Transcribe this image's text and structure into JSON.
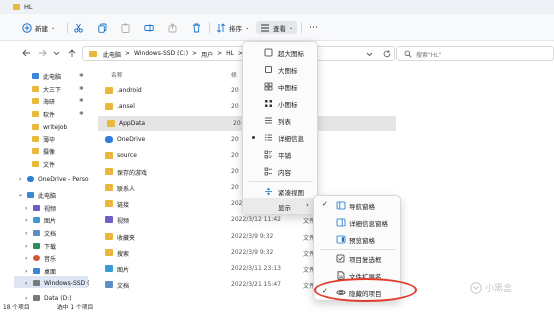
{
  "window": {
    "title": "HL"
  },
  "toolbar": {
    "new_label": "新建",
    "sort_label": "排序",
    "view_label": "查看",
    "more_label": "⋯"
  },
  "address": {
    "crumbs": [
      "此电脑",
      ">",
      "Windows-SSD (C:)",
      ">",
      "用户",
      ">",
      "HL",
      ">"
    ],
    "search_placeholder": "搜索\"HL\""
  },
  "sidebar": {
    "items": [
      {
        "label": "此电脑",
        "color": "#3a86d6"
      },
      {
        "label": "大三下",
        "color": "#e8b93c"
      },
      {
        "label": "海研",
        "color": "#e8b93c"
      },
      {
        "label": "软件",
        "color": "#e8b93c"
      },
      {
        "label": "writeJob",
        "color": "#e8b93c"
      },
      {
        "label": "薄毕",
        "color": "#e8b93c"
      },
      {
        "label": "摄像",
        "color": "#e8b93c"
      },
      {
        "label": "文件",
        "color": "#e8b93c"
      },
      {
        "label": "OneDrive - Perso",
        "color": "#2f7ed8"
      },
      {
        "label": "此电脑",
        "color": "#3a86d6"
      },
      {
        "label": "视频",
        "color": "#6c5fc7"
      },
      {
        "label": "图片",
        "color": "#3a9bd6"
      },
      {
        "label": "文档",
        "color": "#5d8ec7"
      },
      {
        "label": "下载",
        "color": "#2c8c5a"
      },
      {
        "label": "音乐",
        "color": "#d6553a"
      },
      {
        "label": "桌面",
        "color": "#3a86d6"
      },
      {
        "label": "Windows-SSD (",
        "color": "#7a7a7a"
      },
      {
        "label": "Data (D:)",
        "color": "#7a7a7a"
      }
    ],
    "pin_symbol": "✱"
  },
  "files": {
    "headers": {
      "name": "名称",
      "date": "修",
      "type": "类"
    },
    "rows": [
      {
        "name": ".android",
        "date": "20",
        "type": "",
        "color": "#e8b93c"
      },
      {
        "name": ".ansel",
        "date": "20",
        "type": "",
        "color": "#e8b93c"
      },
      {
        "name": "AppData",
        "date": "20",
        "type": "",
        "color": "#e8b93c"
      },
      {
        "name": "OneDrive",
        "date": "20",
        "type": "",
        "color": "#2f7ed8"
      },
      {
        "name": "source",
        "date": "20",
        "type": "",
        "color": "#e8b93c"
      },
      {
        "name": "保存的游戏",
        "date": "20",
        "type": "",
        "color": "#e8b93c"
      },
      {
        "name": "联系人",
        "date": "20",
        "type": "",
        "color": "#e8b93c"
      },
      {
        "name": "链接",
        "date": "2022/3/12 11:40",
        "type": "文件",
        "color": "#e8b93c"
      },
      {
        "name": "视频",
        "date": "2022/3/12 11:42",
        "type": "文件",
        "color": "#6c5fc7"
      },
      {
        "name": "收藏夹",
        "date": "2022/3/9 9:32",
        "type": "文件",
        "color": "#e8b93c"
      },
      {
        "name": "搜索",
        "date": "2022/3/9 9:32",
        "type": "文件",
        "color": "#e8b93c"
      },
      {
        "name": "图片",
        "date": "2022/3/11 23:13",
        "type": "文件",
        "color": "#3a9bd6"
      },
      {
        "name": "文档",
        "date": "2022/3/21 15:47",
        "type": "文件",
        "color": "#5d8ec7"
      }
    ]
  },
  "status": {
    "count": "18 个项目",
    "selected": "选中 1 个项目"
  },
  "view_menu": {
    "items": [
      {
        "label": "超大图标"
      },
      {
        "label": "大图标"
      },
      {
        "label": "中图标"
      },
      {
        "label": "小图标"
      },
      {
        "label": "列表"
      },
      {
        "label": "详细信息"
      },
      {
        "label": "平铺"
      },
      {
        "label": "内容"
      },
      {
        "label": "紧凑视图"
      },
      {
        "label": "显示"
      }
    ]
  },
  "show_menu": {
    "items": [
      {
        "label": "导航窗格"
      },
      {
        "label": "详细信息窗格"
      },
      {
        "label": "预览窗格"
      },
      {
        "label": "项目复选框"
      },
      {
        "label": "文件扩展名"
      },
      {
        "label": "隐藏的项目"
      }
    ]
  },
  "watermark": {
    "text": "小黑盒"
  }
}
